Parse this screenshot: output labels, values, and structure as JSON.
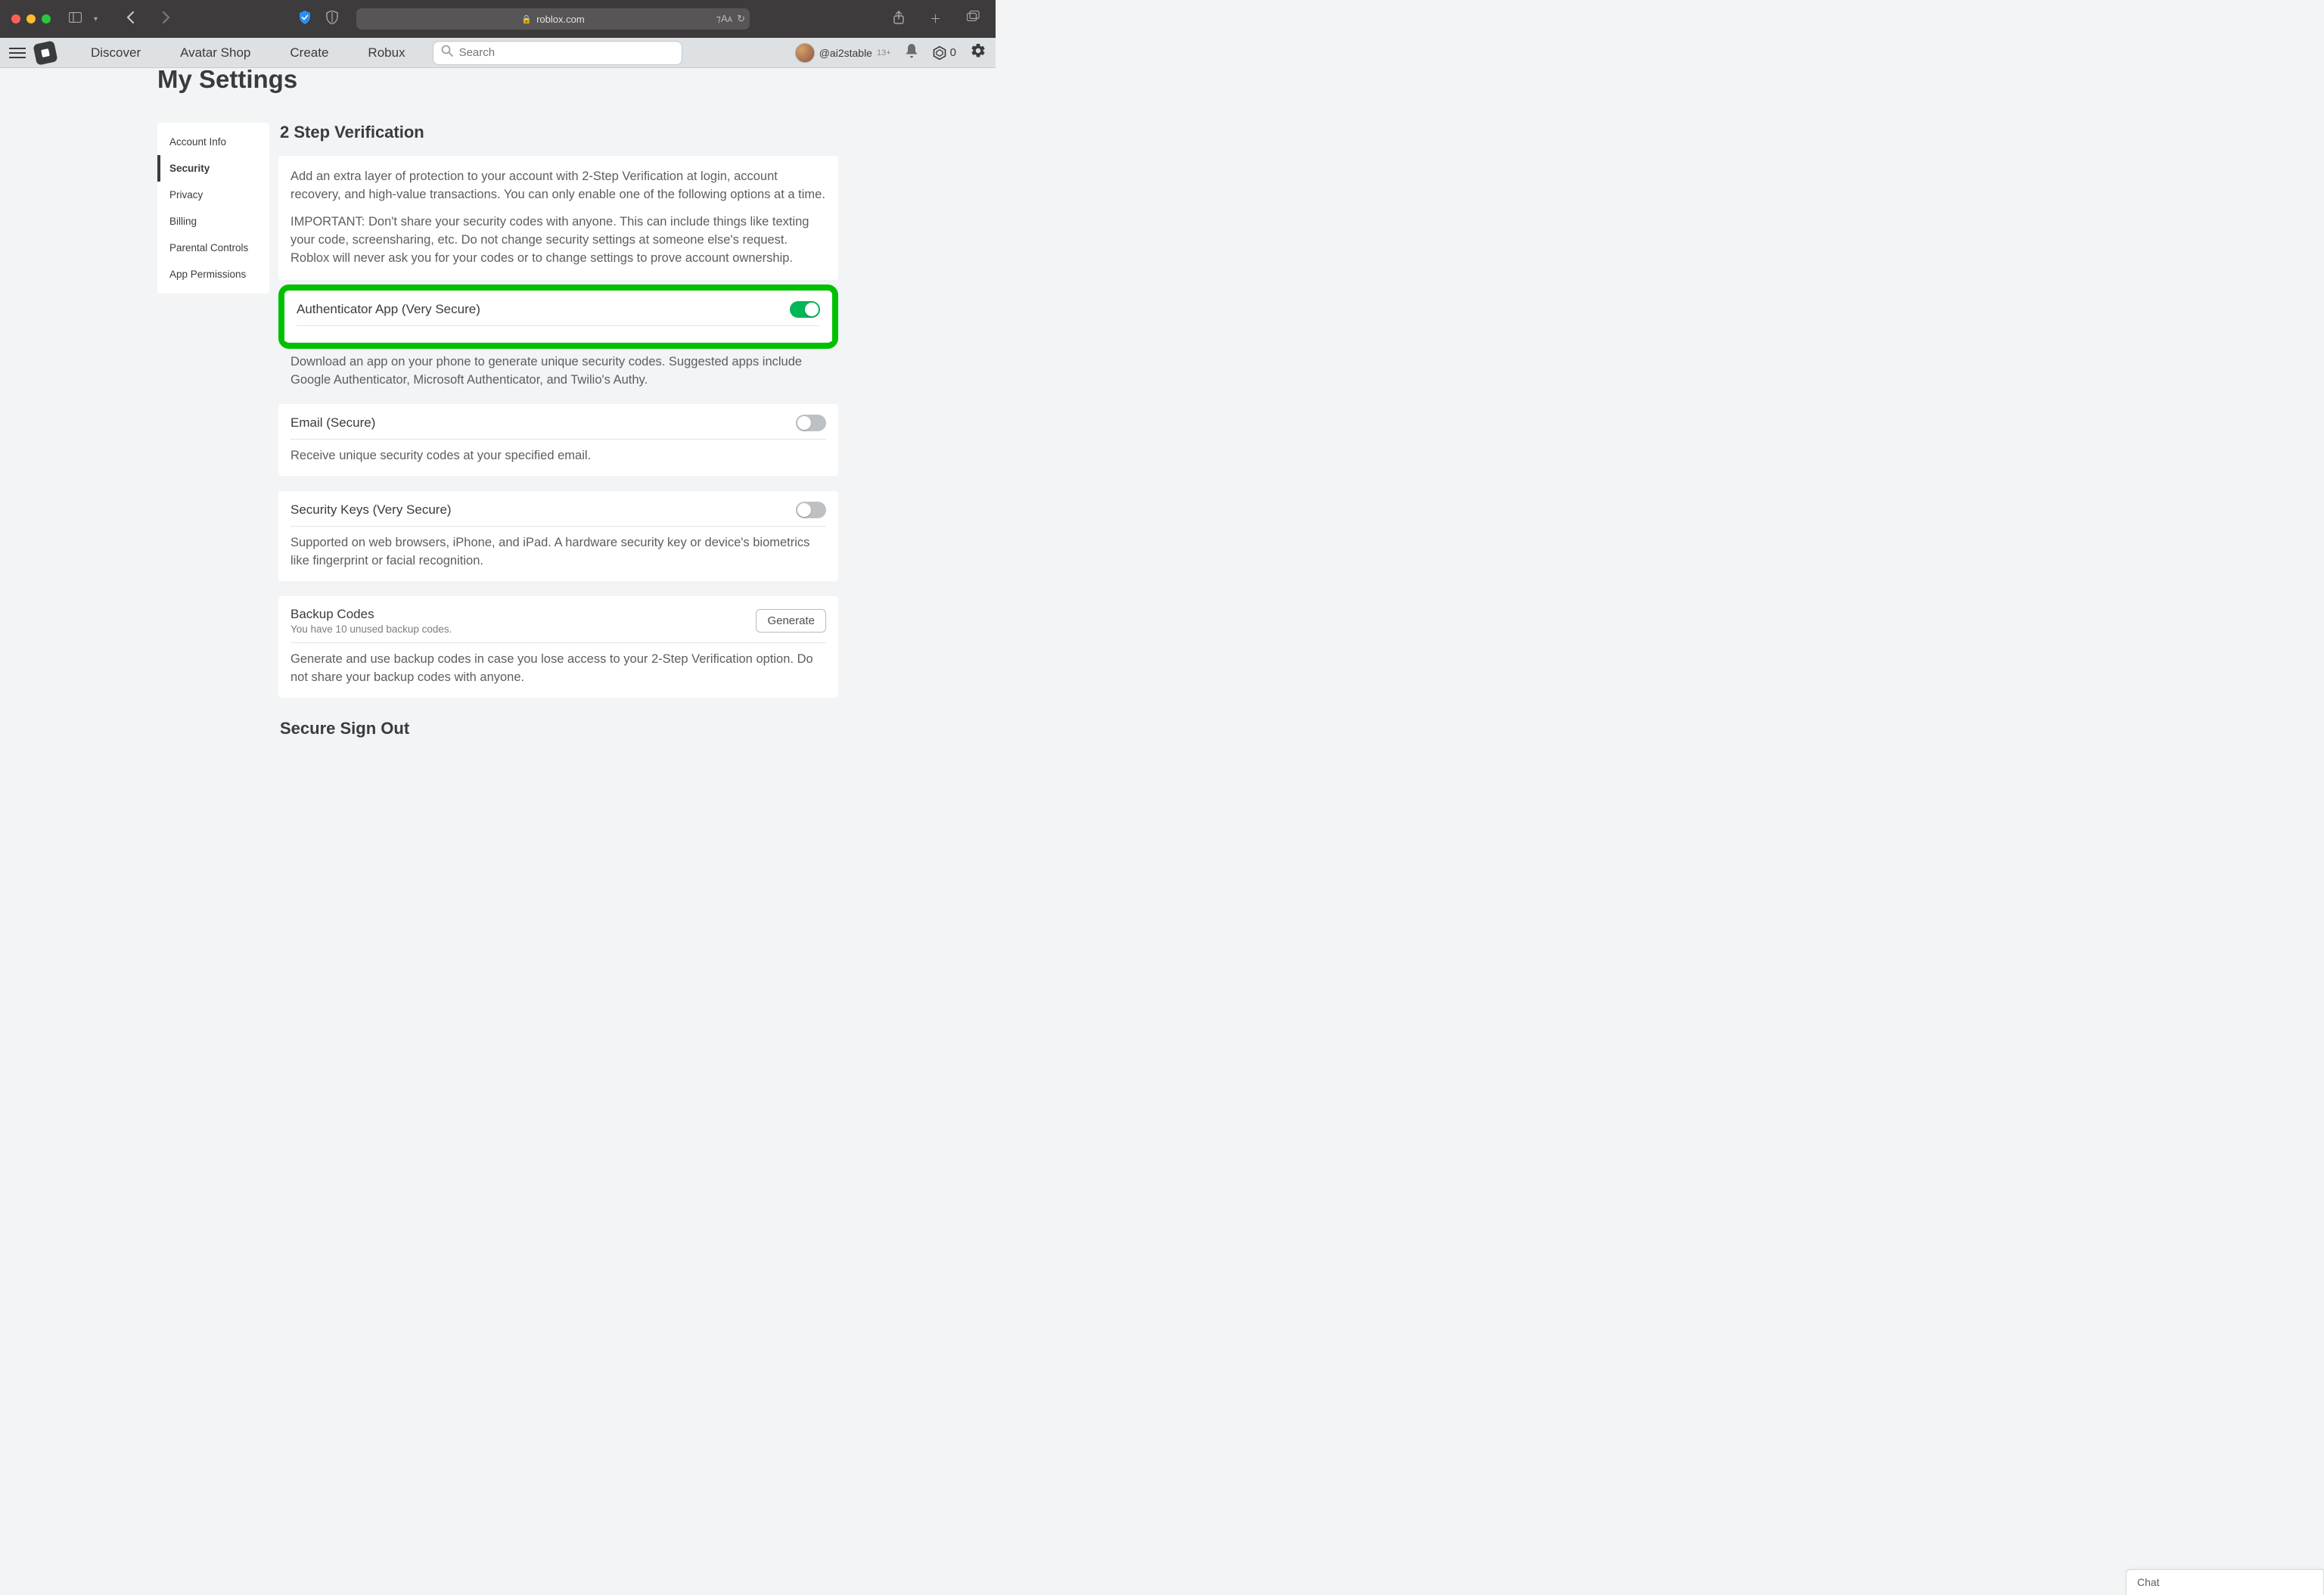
{
  "browser": {
    "url_host": "roblox.com"
  },
  "nav": {
    "links": [
      "Discover",
      "Avatar Shop",
      "Create",
      "Robux"
    ],
    "search_placeholder": "Search",
    "username": "@ai2stable",
    "age_badge": "13+",
    "robux_count": "0"
  },
  "page": {
    "title": "My Settings"
  },
  "sidebar": {
    "items": [
      {
        "label": "Account Info",
        "active": false
      },
      {
        "label": "Security",
        "active": true
      },
      {
        "label": "Privacy",
        "active": false
      },
      {
        "label": "Billing",
        "active": false
      },
      {
        "label": "Parental Controls",
        "active": false
      },
      {
        "label": "App Permissions",
        "active": false
      }
    ]
  },
  "section": {
    "heading": "2 Step Verification",
    "intro_p1": "Add an extra layer of protection to your account with 2-Step Verification at login, account recovery, and high-value transactions. You can only enable one of the following options at a time.",
    "intro_p2": "IMPORTANT: Don't share your security codes with anyone. This can include things like texting your code, screensharing, etc. Do not change security settings at someone else's request. Roblox will never ask you for your codes or to change settings to prove account ownership."
  },
  "options": {
    "authenticator": {
      "title": "Authenticator App (Very Secure)",
      "desc": "Download an app on your phone to generate unique security codes. Suggested apps include Google Authenticator, Microsoft Authenticator, and Twilio's Authy.",
      "enabled": true
    },
    "email": {
      "title": "Email (Secure)",
      "desc": "Receive unique security codes at your specified email.",
      "enabled": false
    },
    "keys": {
      "title": "Security Keys (Very Secure)",
      "desc": "Supported on web browsers, iPhone, and iPad. A hardware security key or device's biometrics like fingerprint or facial recognition.",
      "enabled": false
    },
    "backup": {
      "title": "Backup Codes",
      "subtitle": "You have 10 unused backup codes.",
      "button": "Generate",
      "desc": "Generate and use backup codes in case you lose access to your 2-Step Verification option. Do not share your backup codes with anyone."
    }
  },
  "secure_signout": {
    "heading": "Secure Sign Out"
  },
  "chat": {
    "label": "Chat"
  }
}
